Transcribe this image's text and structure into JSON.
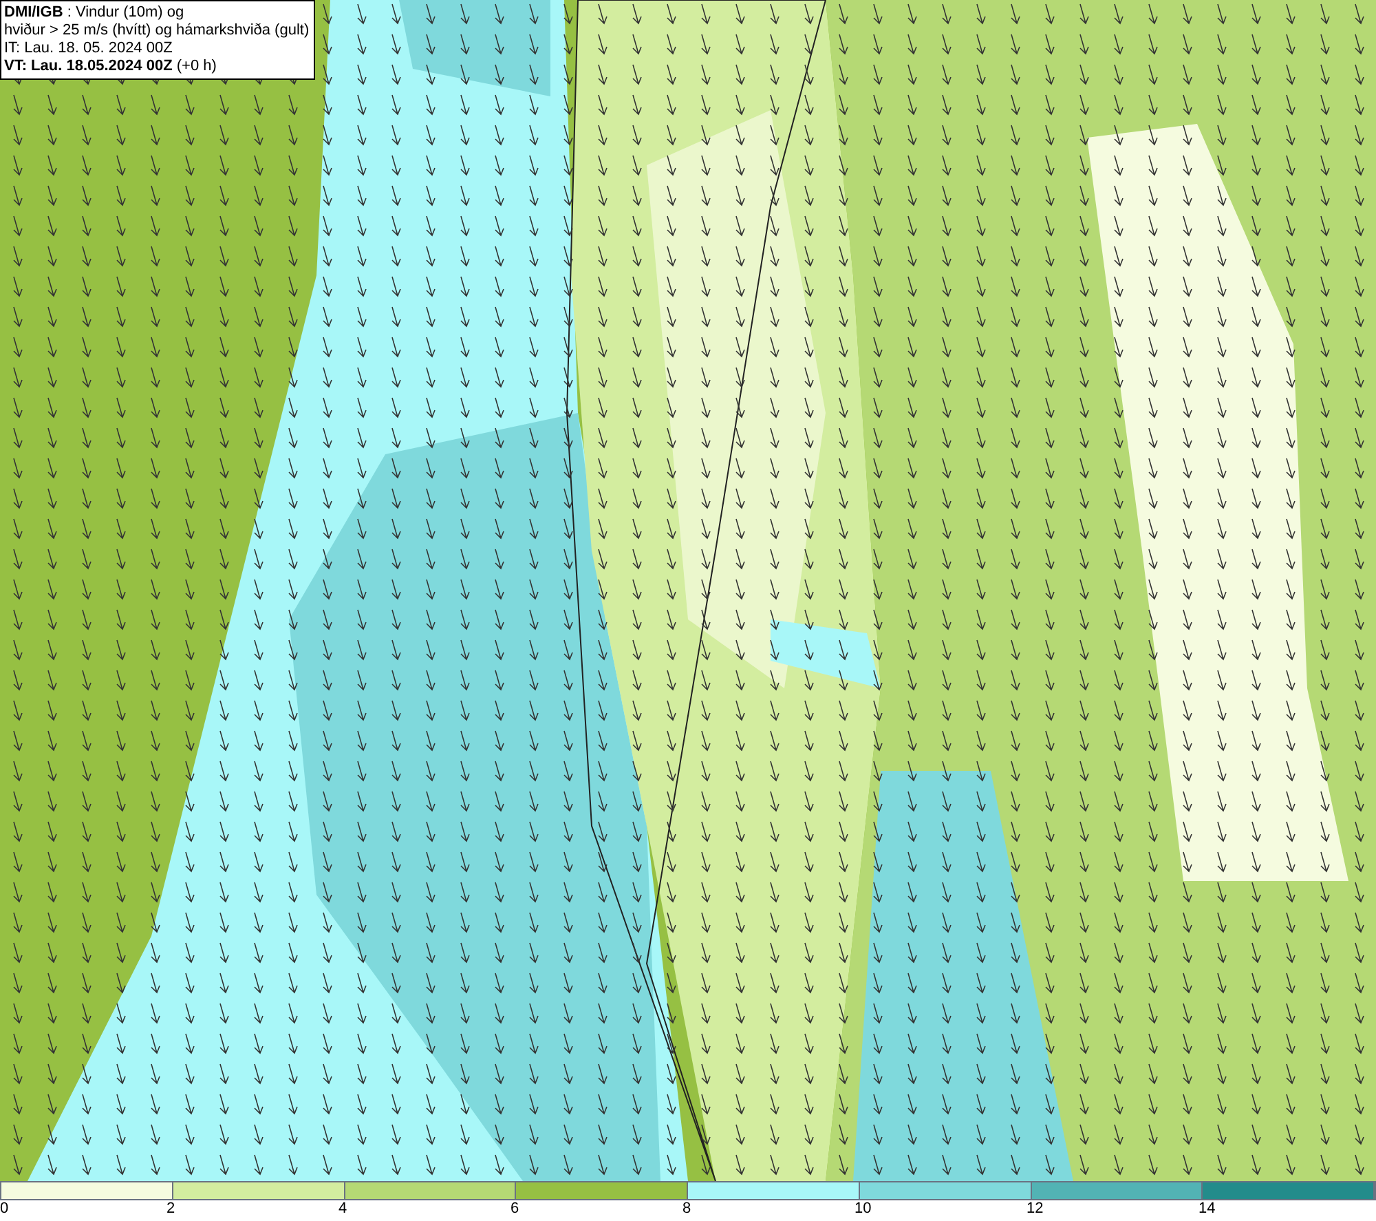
{
  "info_box": {
    "lines": [
      "**DMI/IGB** : Vindur (10m) og",
      "hviður > 25 m/s (hvítt) og hámarkshviða (gult)",
      "IT: Lau. 18. 05. 2024 00Z",
      "**VT: Lau. 18.05.2024 00Z** (+0 h)"
    ]
  },
  "legend": {
    "swatches": [
      {
        "color": "#f5fbdf"
      },
      {
        "color": "#d3ed9f"
      },
      {
        "color": "#b5d974"
      },
      {
        "color": "#96c043"
      },
      {
        "color": "#a8f7f8"
      },
      {
        "color": "#7fd9dc"
      },
      {
        "color": "#52b3b4"
      },
      {
        "color": "#238c8b"
      }
    ],
    "ticks": [
      "0",
      "2",
      "4",
      "6",
      "8",
      "10",
      "12",
      "14"
    ]
  }
}
